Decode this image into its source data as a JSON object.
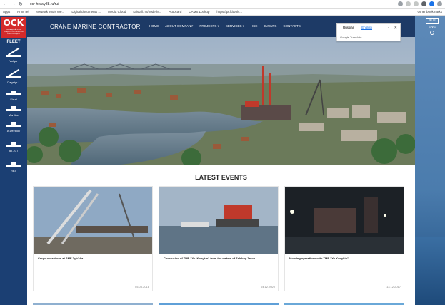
{
  "browser": {
    "url": "ocr-heavy88.ru/ru/",
    "bookmarks": [
      "Apps",
      "Print Tel",
      "Network Tools We...",
      "Digital documents ...",
      "Media Cloud",
      "Kristall.rnt/node.ht...",
      "Autocard",
      "CAMS Lookup",
      "https://pr.fdtools..."
    ],
    "other_bookmarks": "Other bookmarks"
  },
  "sidebar": {
    "logo_text": "ОСК",
    "logo_sub": "ОБЪЕДИНЁННАЯ СУДОСТРОИТЕЛЬНАЯ КОРПОРАЦИЯ",
    "fleet_title": "FLEET",
    "items": [
      {
        "label": "Volgar",
        "icon": "crane-vessel-icon"
      },
      {
        "label": "Dagatyr-1",
        "icon": "crane-vessel-icon"
      },
      {
        "label": "Sirrat",
        "icon": "ship-icon"
      },
      {
        "label": "Martline",
        "icon": "ship-icon"
      },
      {
        "label": "A.Dezinov",
        "icon": "ship-icon"
      },
      {
        "label": "BT-237",
        "icon": "ship-icon"
      },
      {
        "label": "RBT",
        "icon": "ship-icon"
      }
    ]
  },
  "header": {
    "brand": "CRANE MARINE CONTRACTOR",
    "nav": [
      {
        "label": "HOME",
        "active": true
      },
      {
        "label": "ABOUT COMPANY",
        "active": false
      },
      {
        "label": "PROJECTS ▾",
        "active": false
      },
      {
        "label": "SERVICES ▾",
        "active": false
      },
      {
        "label": "HSE",
        "active": false
      },
      {
        "label": "EVENTS",
        "active": false
      },
      {
        "label": "CONTACTS",
        "active": false
      }
    ]
  },
  "translate": {
    "lang_from": "Russian",
    "lang_to": "English",
    "powered": "Google Translate"
  },
  "controls": {
    "lang1": "RUS",
    "lang2": "ENG"
  },
  "events": {
    "title": "LATEST EVENTS",
    "cards": [
      {
        "caption": "Cargo operations at SME Zyb'ska",
        "date": "05.05.2018"
      },
      {
        "caption": "Conclusion of TMB \"Yu. Konykin\" from the waters of Zeleboy Zaton",
        "date": "04.12.2020"
      },
      {
        "caption": "Mooring operations with TMB \"Yu.Konykin\"",
        "date": "13.12.2017"
      }
    ]
  }
}
